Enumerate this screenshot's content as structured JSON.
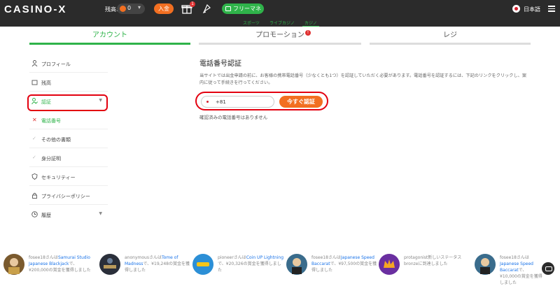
{
  "header": {
    "logo": "CASINO-X",
    "balance_label": "残高:",
    "balance_value": "0",
    "deposit_label": "入金",
    "gift_badge": "1",
    "free_money_label": "フリーマネー",
    "language": "日本語"
  },
  "subnav": [
    "スポーツ",
    "ライブカジノ",
    "カジノ"
  ],
  "tabs": [
    "アカウント",
    "プロモーション",
    "レジ"
  ],
  "promo_badge": "!",
  "sidebar": {
    "profile": "プロフィール",
    "balance": "残高",
    "verification": "認証",
    "phone": "電話番号",
    "other_docs": "その他の書類",
    "identity": "身分証明",
    "security": "セキュリティー",
    "privacy": "プライバシーポリシー",
    "history": "履歴"
  },
  "content": {
    "title": "電話番号認証",
    "description": "当サイトでは出金申請の前に、お客様の携帯電話番号（少なくとも1つ）を認証していただく必要があります。電話番号を認証するには、下記のリンクをクリックし、案内に従って手続きを行ってください。",
    "phone_prefix": "+81",
    "verify_button": "今すぐ認証",
    "no_verified": "確認済みの電話番号はありません"
  },
  "wins": [
    {
      "pre": "fosee18さんは",
      "game": "Samurai Studio Japanese Blackjack",
      "post": "で、¥200,000の賞金を獲得しました"
    },
    {
      "pre": "anonymousさんは",
      "game": "Tome of Madness",
      "post": "で、¥19,248の賞金を獲得しました"
    },
    {
      "pre": "pioneerさんは",
      "game": "Coin UP Lightning",
      "post": "で、¥20,326の賞金を獲得しました"
    },
    {
      "pre": "fosee18さんは",
      "game": "Japanese Speed Baccarat",
      "post": "で、¥97,500の賞金を獲得しました"
    },
    {
      "pre": "protagonist",
      "game": "",
      "post": "新しいステータスbronzeに到達しました"
    },
    {
      "pre": "fosee18さんは",
      "game": "Japanese Speed Baccarat",
      "post": "で、¥10,000の賞金を獲得しました"
    }
  ],
  "colors": {
    "accent_green": "#2fb34a",
    "accent_orange": "#f26f21",
    "highlight_red": "#e3000f",
    "topbar": "#2b2b2b"
  }
}
